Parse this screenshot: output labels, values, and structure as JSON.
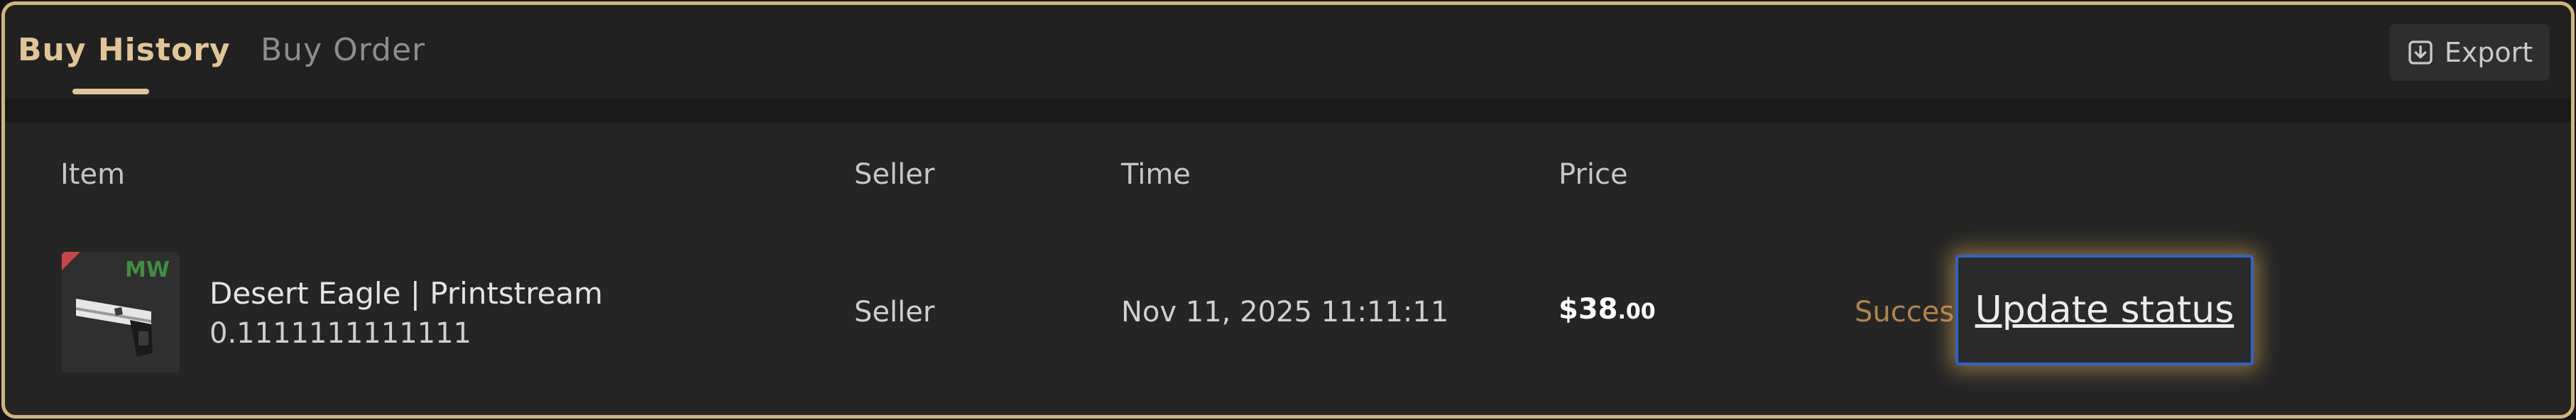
{
  "tabs": [
    {
      "label": "Buy History",
      "active": true
    },
    {
      "label": "Buy Order",
      "active": false
    }
  ],
  "toolbar": {
    "export_label": "Export",
    "export_icon": "download-box-icon"
  },
  "table": {
    "columns": [
      "Item",
      "Seller",
      "Time",
      "Price"
    ],
    "rows": [
      {
        "item_name": "Desert Eagle | Printstream",
        "float_value": "0.1111111111111",
        "wear": "MW",
        "seller": "Seller",
        "time": "Nov 11, 2025 11:11:11",
        "price_main": "$38",
        "price_cents": ".00",
        "status": "Success",
        "action_label": "Update status"
      }
    ]
  },
  "colors": {
    "accent": "#e3c494",
    "frame_border": "#d4b47a",
    "status_success": "#b3834a",
    "focus_ring": "#2f64c9",
    "wear_badge": "#3f8f3f"
  }
}
